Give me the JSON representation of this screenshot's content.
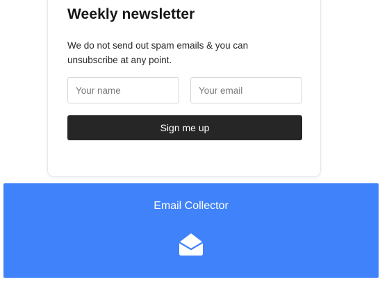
{
  "newsletter": {
    "title": "Weekly newsletter",
    "description": "We do not send out spam emails & you can unsubscribe at any point.",
    "name_placeholder": "Your name",
    "email_placeholder": "Your email",
    "submit_label": "Sign me up"
  },
  "collector": {
    "title": "Email Collector",
    "icon": "envelope-open-icon"
  },
  "colors": {
    "button_bg": "#262626",
    "panel_bg": "#3f82fa",
    "card_border": "#e6e8ef"
  }
}
